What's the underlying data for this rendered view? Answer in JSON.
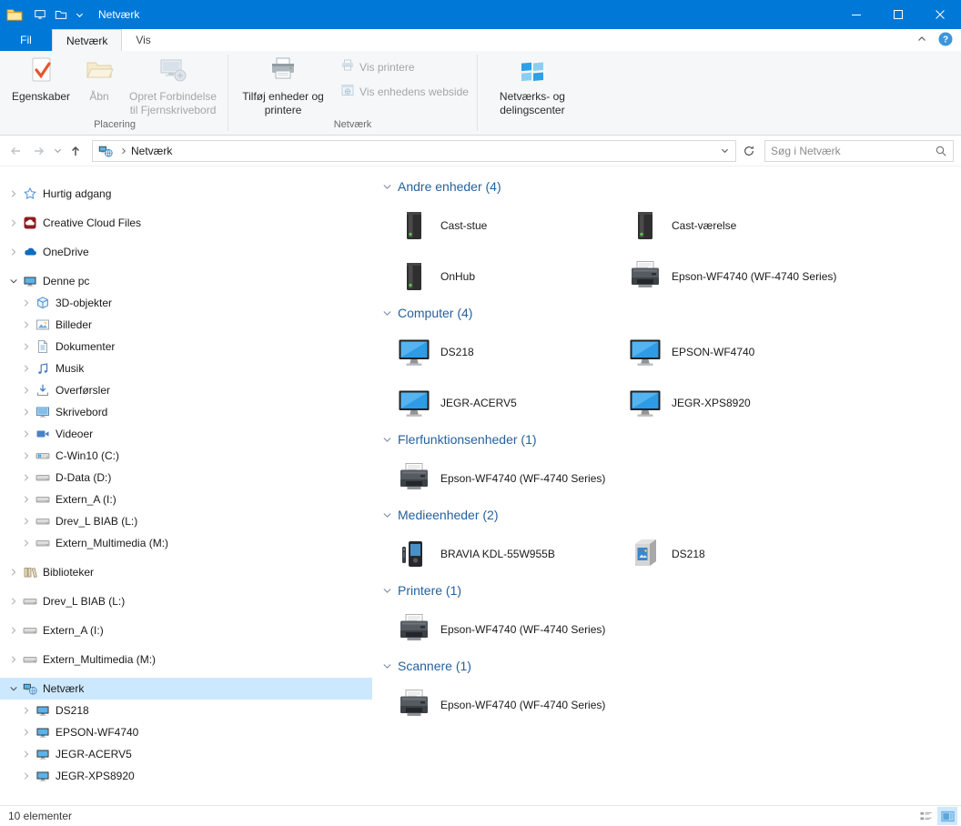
{
  "colors": {
    "accent": "#0078d7",
    "selection": "#cce8ff",
    "group_header": "#26619c"
  },
  "titlebar": {
    "title": "Netværk"
  },
  "ribbon": {
    "tabs": [
      {
        "label": "Fil"
      },
      {
        "label": "Netværk"
      },
      {
        "label": "Vis"
      }
    ],
    "groups": [
      {
        "label": "Placering",
        "buttons": [
          {
            "label": "Egenskaber",
            "icon": "properties",
            "enabled": true
          },
          {
            "label": "Åbn",
            "icon": "open-folder",
            "enabled": false
          },
          {
            "label": "Opret Forbindelse til Fjernskrivebord",
            "icon": "remote-desktop",
            "enabled": false
          }
        ]
      },
      {
        "label": "Netværk",
        "buttons": [
          {
            "label": "Tilføj enheder og printere",
            "icon": "add-devices-printers",
            "enabled": true
          },
          {
            "label": "Vis printere",
            "icon": "view-printers",
            "enabled": false
          },
          {
            "label": "Vis enhedens webside",
            "icon": "device-webpage",
            "enabled": false
          }
        ]
      },
      {
        "label": "",
        "buttons": [
          {
            "label": "Netværks- og delingscenter",
            "icon": "network-sharing-center",
            "enabled": true
          }
        ]
      }
    ]
  },
  "addressbar": {
    "path_item": "Netværk",
    "search_placeholder": "Søg i Netværk"
  },
  "sidebar": {
    "items": [
      {
        "label": "Hurtig adgang",
        "icon": "star",
        "level": 0,
        "chevron": "right",
        "root": true
      },
      {
        "label": "Creative Cloud Files",
        "icon": "creative-cloud",
        "level": 0,
        "chevron": "right",
        "root": true
      },
      {
        "label": "OneDrive",
        "icon": "onedrive",
        "level": 0,
        "chevron": "right",
        "root": true
      },
      {
        "label": "Denne pc",
        "icon": "pc",
        "level": 0,
        "chevron": "down",
        "root": true
      },
      {
        "label": "3D-objekter",
        "icon": "cube",
        "level": 1,
        "chevron": "right"
      },
      {
        "label": "Billeder",
        "icon": "pictures",
        "level": 1,
        "chevron": "right"
      },
      {
        "label": "Dokumenter",
        "icon": "documents",
        "level": 1,
        "chevron": "right"
      },
      {
        "label": "Musik",
        "icon": "music",
        "level": 1,
        "chevron": "right"
      },
      {
        "label": "Overførsler",
        "icon": "downloads",
        "level": 1,
        "chevron": "right"
      },
      {
        "label": "Skrivebord",
        "icon": "desktop",
        "level": 1,
        "chevron": "right"
      },
      {
        "label": "Videoer",
        "icon": "videos",
        "level": 1,
        "chevron": "right"
      },
      {
        "label": "C-Win10 (C:)",
        "icon": "drive-win",
        "level": 1,
        "chevron": "right"
      },
      {
        "label": "D-Data (D:)",
        "icon": "drive",
        "level": 1,
        "chevron": "right"
      },
      {
        "label": "Extern_A (I:)",
        "icon": "drive",
        "level": 1,
        "chevron": "right"
      },
      {
        "label": "Drev_L BIAB (L:)",
        "icon": "drive",
        "level": 1,
        "chevron": "right"
      },
      {
        "label": "Extern_Multimedia (M:)",
        "icon": "drive",
        "level": 1,
        "chevron": "right"
      },
      {
        "label": "Biblioteker",
        "icon": "library",
        "level": 0,
        "chevron": "right",
        "root": true
      },
      {
        "label": "Drev_L BIAB (L:)",
        "icon": "drive",
        "level": 0,
        "chevron": "right",
        "root": true
      },
      {
        "label": "Extern_A (I:)",
        "icon": "drive",
        "level": 0,
        "chevron": "right",
        "root": true
      },
      {
        "label": "Extern_Multimedia (M:)",
        "icon": "drive",
        "level": 0,
        "chevron": "right",
        "root": true
      },
      {
        "label": "Netværk",
        "icon": "network",
        "level": 0,
        "chevron": "down",
        "root": true,
        "selected": true
      },
      {
        "label": "DS218",
        "icon": "pc",
        "level": 1,
        "chevron": "right"
      },
      {
        "label": "EPSON-WF4740",
        "icon": "pc",
        "level": 1,
        "chevron": "right"
      },
      {
        "label": "JEGR-ACERV5",
        "icon": "pc",
        "level": 1,
        "chevron": "right"
      },
      {
        "label": "JEGR-XPS8920",
        "icon": "pc",
        "level": 1,
        "chevron": "right"
      }
    ]
  },
  "content": {
    "groups": [
      {
        "label": "Andre enheder (4)",
        "items": [
          {
            "name": "Cast-stue",
            "icon": "cast-device"
          },
          {
            "name": "Cast-værelse",
            "icon": "cast-device"
          },
          {
            "name": "OnHub",
            "icon": "cast-device"
          },
          {
            "name": "Epson-WF4740 (WF-4740 Series)",
            "icon": "printer"
          }
        ]
      },
      {
        "label": "Computer (4)",
        "items": [
          {
            "name": "DS218",
            "icon": "computer"
          },
          {
            "name": "EPSON-WF4740",
            "icon": "computer"
          },
          {
            "name": "JEGR-ACERV5",
            "icon": "computer"
          },
          {
            "name": "JEGR-XPS8920",
            "icon": "computer"
          }
        ]
      },
      {
        "label": "Flerfunktionsenheder (1)",
        "items": [
          {
            "name": "Epson-WF4740 (WF-4740 Series)",
            "icon": "printer"
          }
        ]
      },
      {
        "label": "Medieenheder (2)",
        "items": [
          {
            "name": "BRAVIA KDL-55W955B",
            "icon": "media-player"
          },
          {
            "name": "DS218",
            "icon": "media-server"
          }
        ]
      },
      {
        "label": "Printere (1)",
        "items": [
          {
            "name": "Epson-WF4740 (WF-4740 Series)",
            "icon": "printer"
          }
        ]
      },
      {
        "label": "Scannere (1)",
        "items": [
          {
            "name": "Epson-WF4740 (WF-4740 Series)",
            "icon": "scanner"
          }
        ]
      }
    ]
  },
  "statusbar": {
    "items_text": "10 elementer"
  }
}
